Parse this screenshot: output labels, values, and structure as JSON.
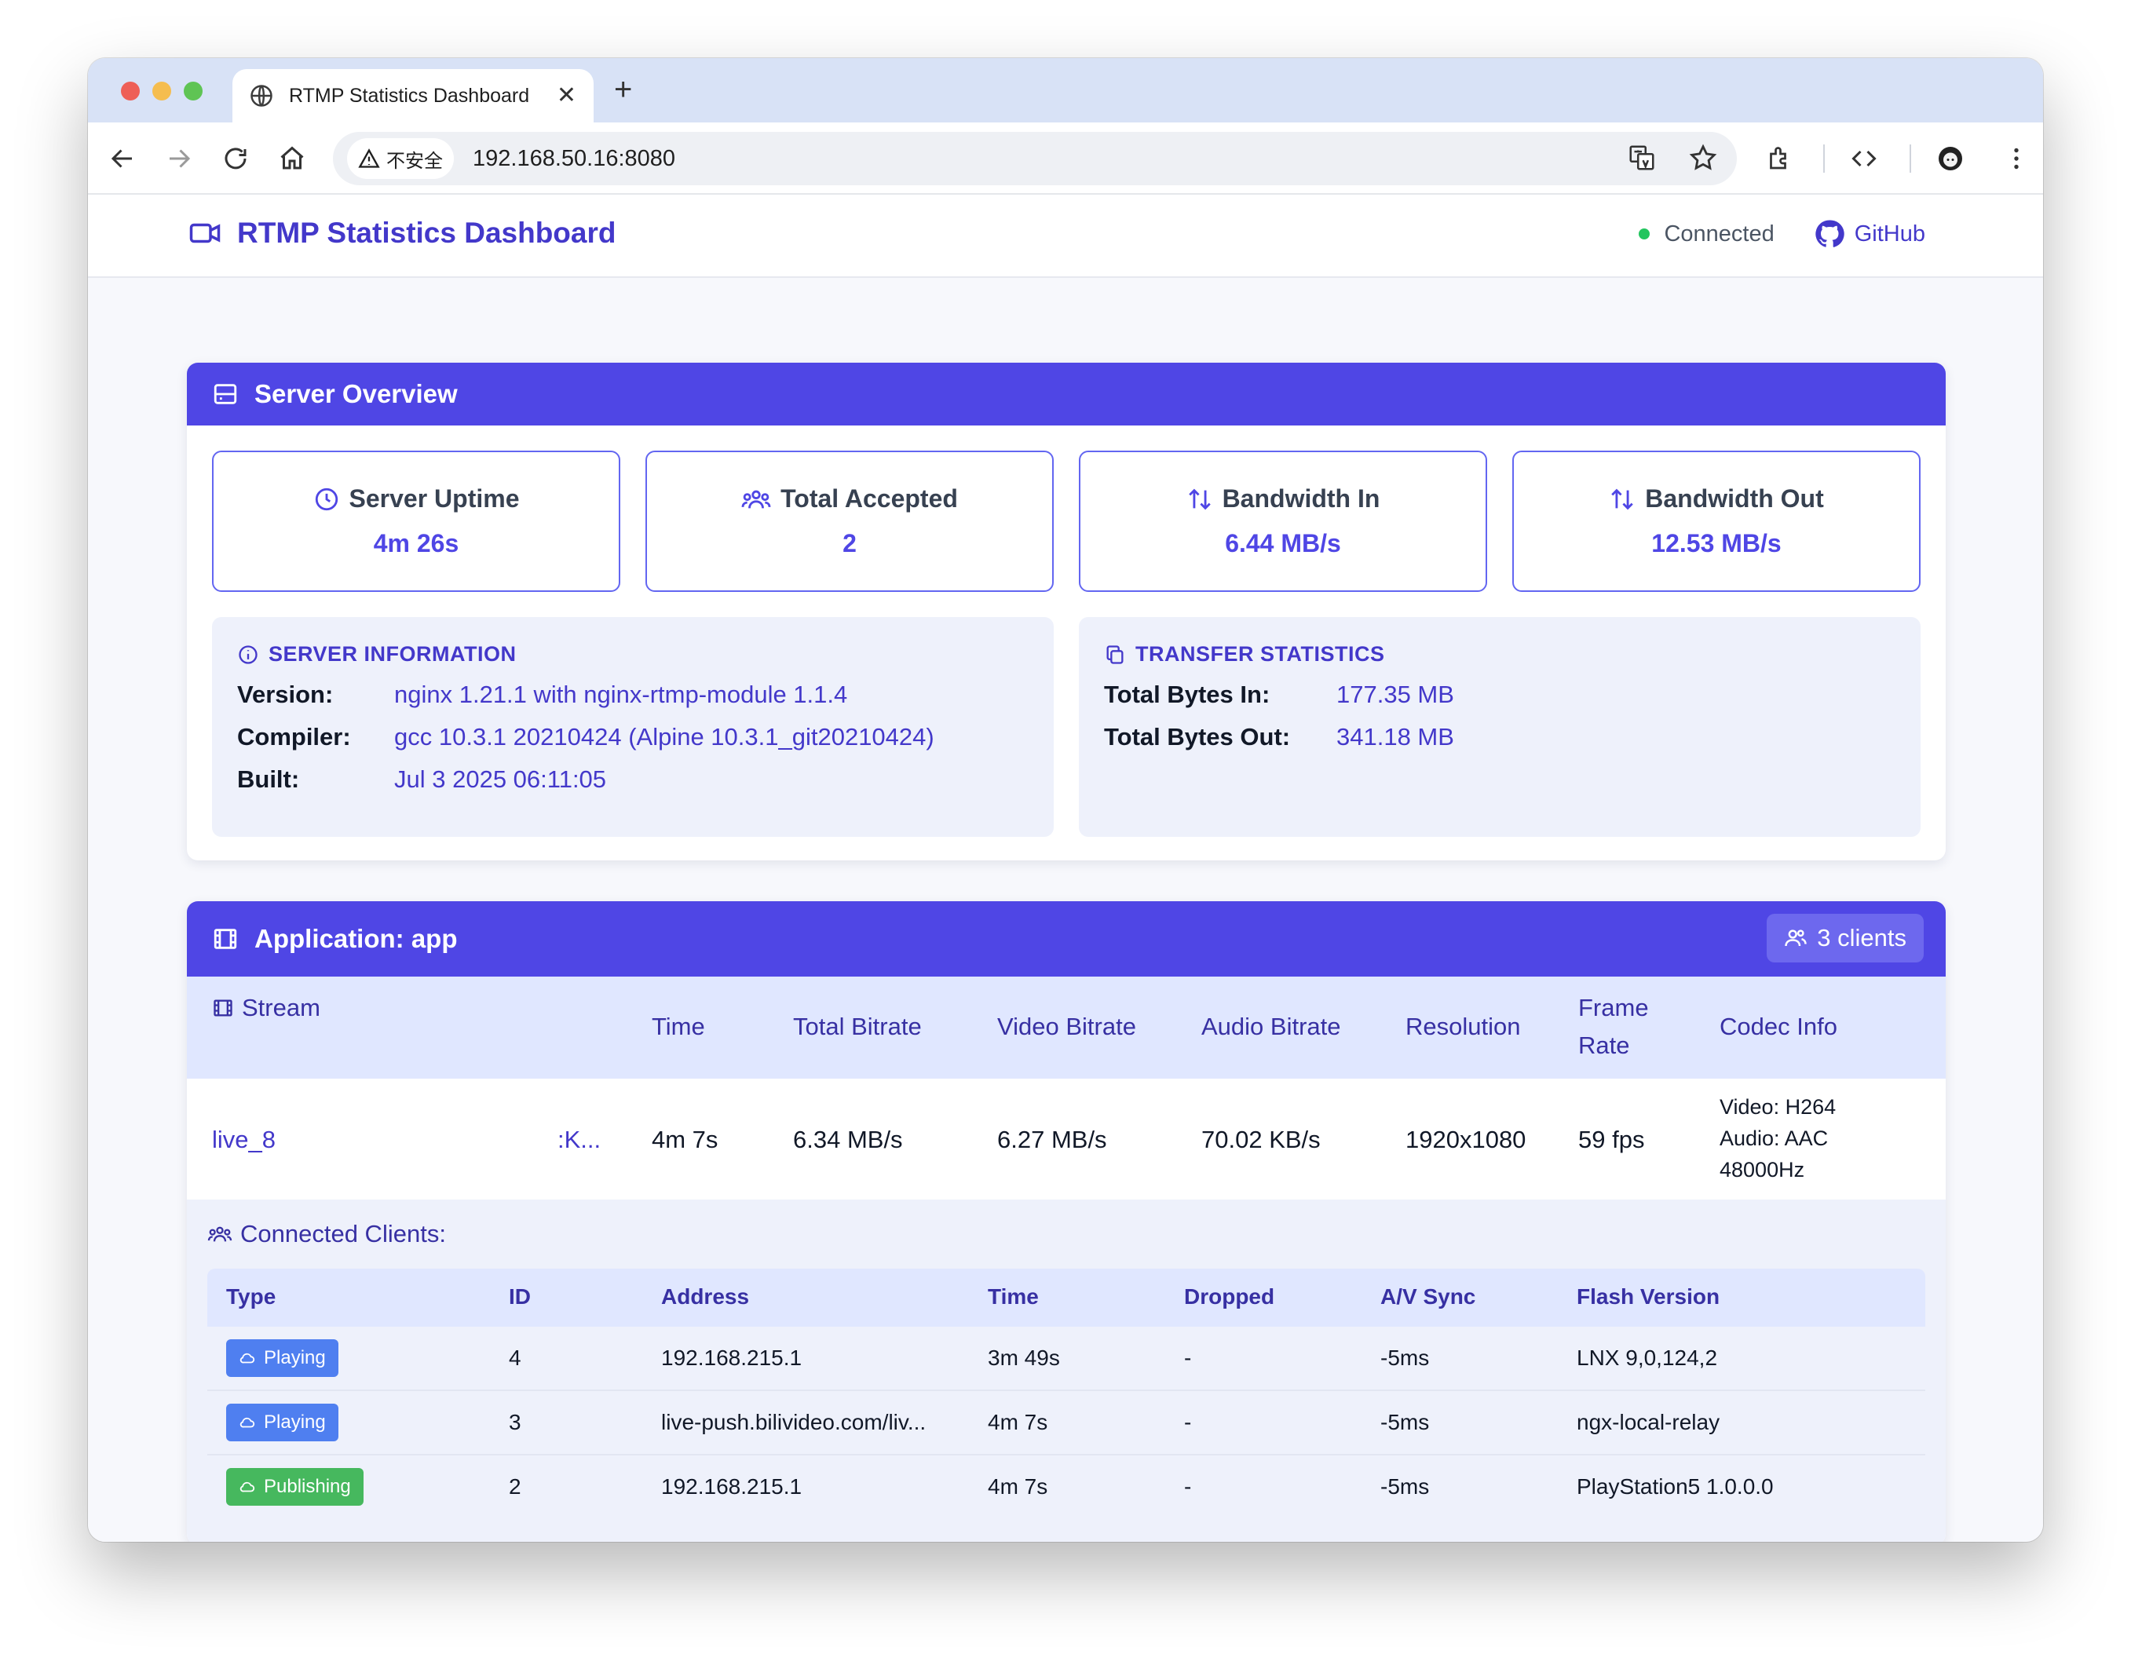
{
  "browser": {
    "tab_title": "RTMP Statistics Dashboard",
    "new_tab": "+",
    "close": "✕",
    "security_label": "不安全",
    "url": "192.168.50.16:8080"
  },
  "header": {
    "title": "RTMP Statistics Dashboard",
    "status": "Connected",
    "github": "GitHub"
  },
  "overview": {
    "title": "Server Overview",
    "stats": [
      {
        "label": "Server Uptime",
        "value": "4m 26s"
      },
      {
        "label": "Total Accepted",
        "value": "2"
      },
      {
        "label": "Bandwidth In",
        "value": "6.44 MB/s"
      },
      {
        "label": "Bandwidth Out",
        "value": "12.53 MB/s"
      }
    ],
    "server_info": {
      "title": "SERVER INFORMATION",
      "rows": [
        {
          "key": "Version:",
          "value": "nginx 1.21.1 with nginx-rtmp-module 1.1.4"
        },
        {
          "key": "Compiler:",
          "value": "gcc 10.3.1 20210424 (Alpine 10.3.1_git20210424)"
        },
        {
          "key": "Built:",
          "value": "Jul 3 2025 06:11:05"
        }
      ]
    },
    "transfer": {
      "title": "TRANSFER STATISTICS",
      "rows": [
        {
          "key": "Total Bytes In:",
          "value": "177.35 MB"
        },
        {
          "key": "Total Bytes Out:",
          "value": "341.18 MB"
        }
      ]
    }
  },
  "application": {
    "title": "Application: app",
    "clients_badge": "3 clients",
    "columns": {
      "stream": "Stream",
      "time": "Time",
      "total_bitrate": "Total Bitrate",
      "video_bitrate": "Video Bitrate",
      "audio_bitrate": "Audio Bitrate",
      "resolution": "Resolution",
      "frame_rate_1": "Frame",
      "frame_rate_2": "Rate",
      "codec": "Codec Info"
    },
    "stream": {
      "name": "live_8",
      "key": ":K...",
      "time": "4m 7s",
      "total_bitrate": "6.34 MB/s",
      "video_bitrate": "6.27 MB/s",
      "audio_bitrate": "70.02 KB/s",
      "resolution": "1920x1080",
      "frame_rate": "59 fps",
      "codec_video": "Video: H264",
      "codec_audio": "Audio: AAC",
      "codec_rate": "48000Hz"
    },
    "clients_label": "Connected Clients:",
    "client_columns": [
      "Type",
      "ID",
      "Address",
      "Time",
      "Dropped",
      "A/V Sync",
      "Flash Version"
    ],
    "clients": [
      {
        "type": "Playing",
        "id": "4",
        "address": "192.168.215.1",
        "time": "3m 49s",
        "dropped": "-",
        "sync": "-5ms",
        "flash": "LNX 9,0,124,2",
        "color": "#4f7ff0"
      },
      {
        "type": "Playing",
        "id": "3",
        "address": "live-push.bilivideo.com/liv...",
        "time": "4m 7s",
        "dropped": "-",
        "sync": "-5ms",
        "flash": "ngx-local-relay",
        "color": "#4f7ff0"
      },
      {
        "type": "Publishing",
        "id": "2",
        "address": "192.168.215.1",
        "time": "4m 7s",
        "dropped": "-",
        "sync": "-5ms",
        "flash": "PlayStation5 1.0.0.0",
        "color": "#46b85e"
      }
    ]
  },
  "colors": {
    "accent": "#4f46e5",
    "status_online": "#22c55e"
  }
}
